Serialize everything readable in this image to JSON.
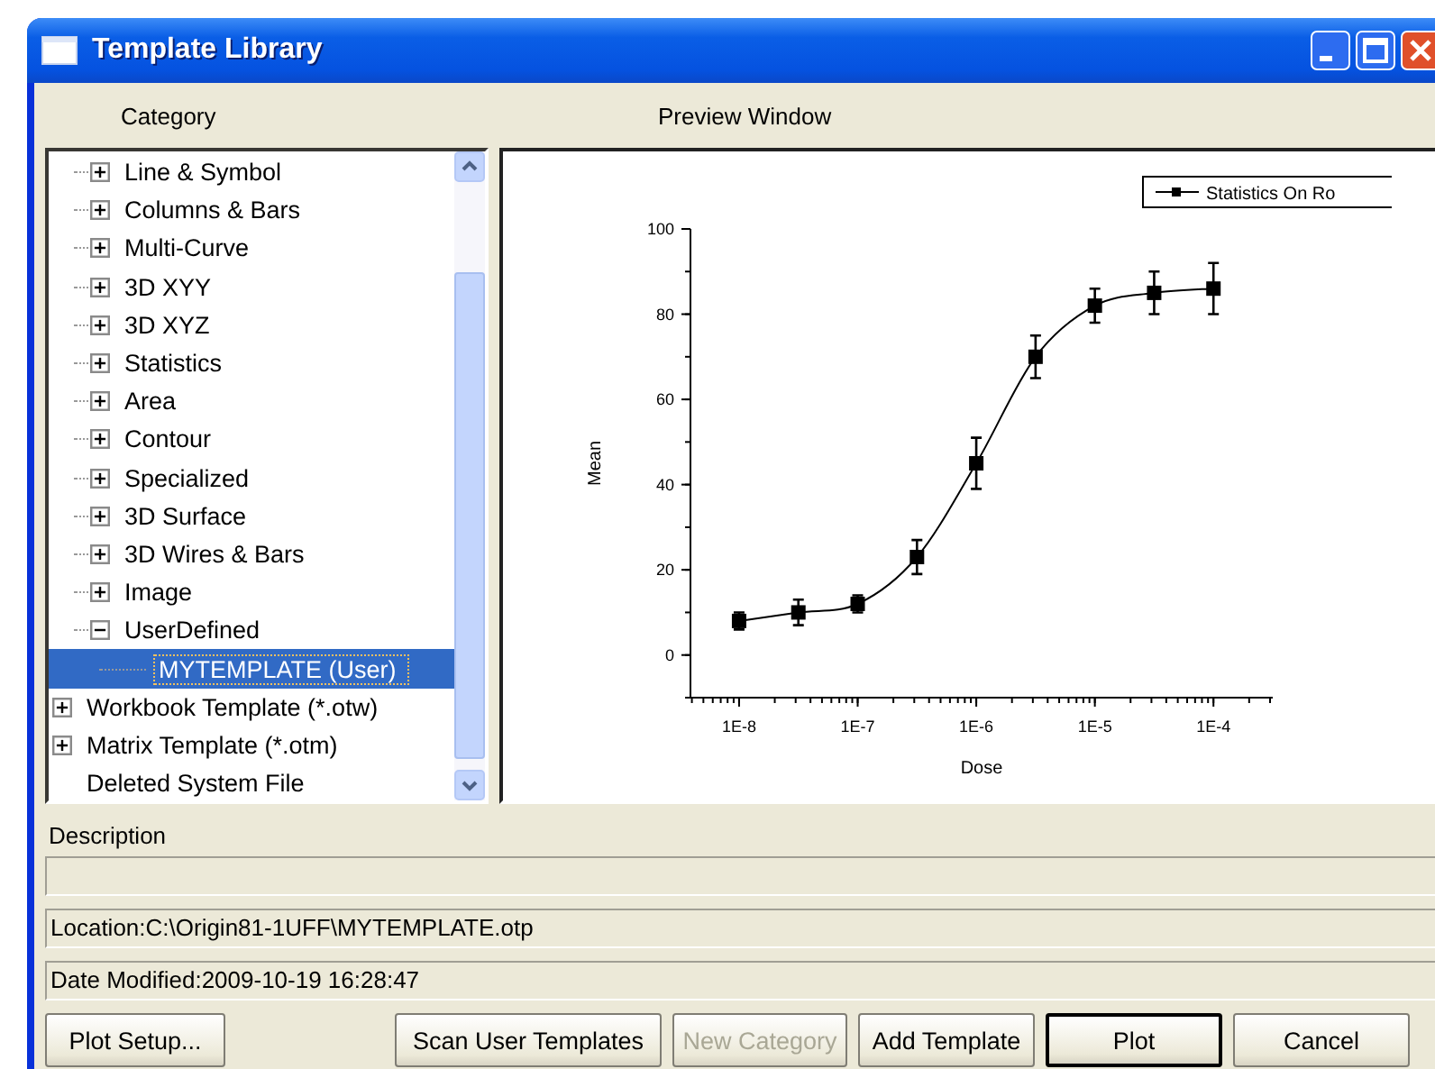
{
  "window": {
    "title": "Template Library"
  },
  "category": {
    "label": "Category",
    "tree": [
      {
        "children": [
          {
            "label": "Line & Symbol",
            "expanded": false,
            "selected": false
          },
          {
            "label": "Columns & Bars",
            "expanded": false,
            "selected": false
          },
          {
            "label": "Multi-Curve",
            "expanded": false,
            "selected": false
          },
          {
            "label": "3D XYY",
            "expanded": false,
            "selected": false
          },
          {
            "label": "3D XYZ",
            "expanded": false,
            "selected": false
          },
          {
            "label": "Statistics",
            "expanded": false,
            "selected": false
          },
          {
            "label": "Area",
            "expanded": false,
            "selected": false
          },
          {
            "label": "Contour",
            "expanded": false,
            "selected": false
          },
          {
            "label": "Specialized",
            "expanded": false,
            "selected": false
          },
          {
            "label": "3D Surface",
            "expanded": false,
            "selected": false
          },
          {
            "label": "3D Wires & Bars",
            "expanded": false,
            "selected": false
          },
          {
            "label": "Image",
            "expanded": false,
            "selected": false
          },
          {
            "label": "UserDefined",
            "expanded": true,
            "selected": false,
            "children": [
              {
                "label": "MYTEMPLATE (User)",
                "selected": true
              }
            ]
          }
        ]
      },
      {
        "label": "Workbook Template (*.otw)",
        "expanded": false,
        "selected": false
      },
      {
        "label": "Matrix Template (*.otm)",
        "expanded": false,
        "selected": false
      },
      {
        "label": "Deleted System File",
        "selected": false
      }
    ]
  },
  "preview": {
    "label": "Preview Window",
    "chart_data": {
      "type": "line",
      "xlabel": "Dose",
      "ylabel": "Mean",
      "categories": [
        "1E-8",
        null,
        "1E-7",
        null,
        "1E-6",
        null,
        "1E-5",
        null,
        "1E-4"
      ],
      "ylim": [
        -10,
        100
      ],
      "yticks": [
        0,
        20,
        40,
        60,
        80,
        100
      ],
      "series": [
        {
          "name": "Statistics On Ro",
          "color": "#000000",
          "marker": "square",
          "values": [
            8,
            10,
            12,
            23,
            45,
            70,
            82,
            85,
            86
          ],
          "errors": [
            2,
            3,
            2,
            4,
            6,
            5,
            4,
            5,
            6
          ]
        }
      ]
    }
  },
  "description": {
    "label": "Description"
  },
  "location": "Location:C:\\Origin81-1UFF\\MYTEMPLATE.otp",
  "date_modified": "Date Modified:2009-10-19 16:28:47",
  "buttons": [
    {
      "label": "Plot Setup...",
      "disabled": false,
      "default": false
    },
    {
      "label": "Scan User Templates",
      "disabled": false,
      "default": false
    },
    {
      "label": "New Category",
      "disabled": true,
      "default": false
    },
    {
      "label": "Add Template",
      "disabled": false,
      "default": false
    },
    {
      "label": "Plot",
      "disabled": false,
      "default": true
    },
    {
      "label": "Cancel",
      "disabled": false,
      "default": false
    }
  ]
}
